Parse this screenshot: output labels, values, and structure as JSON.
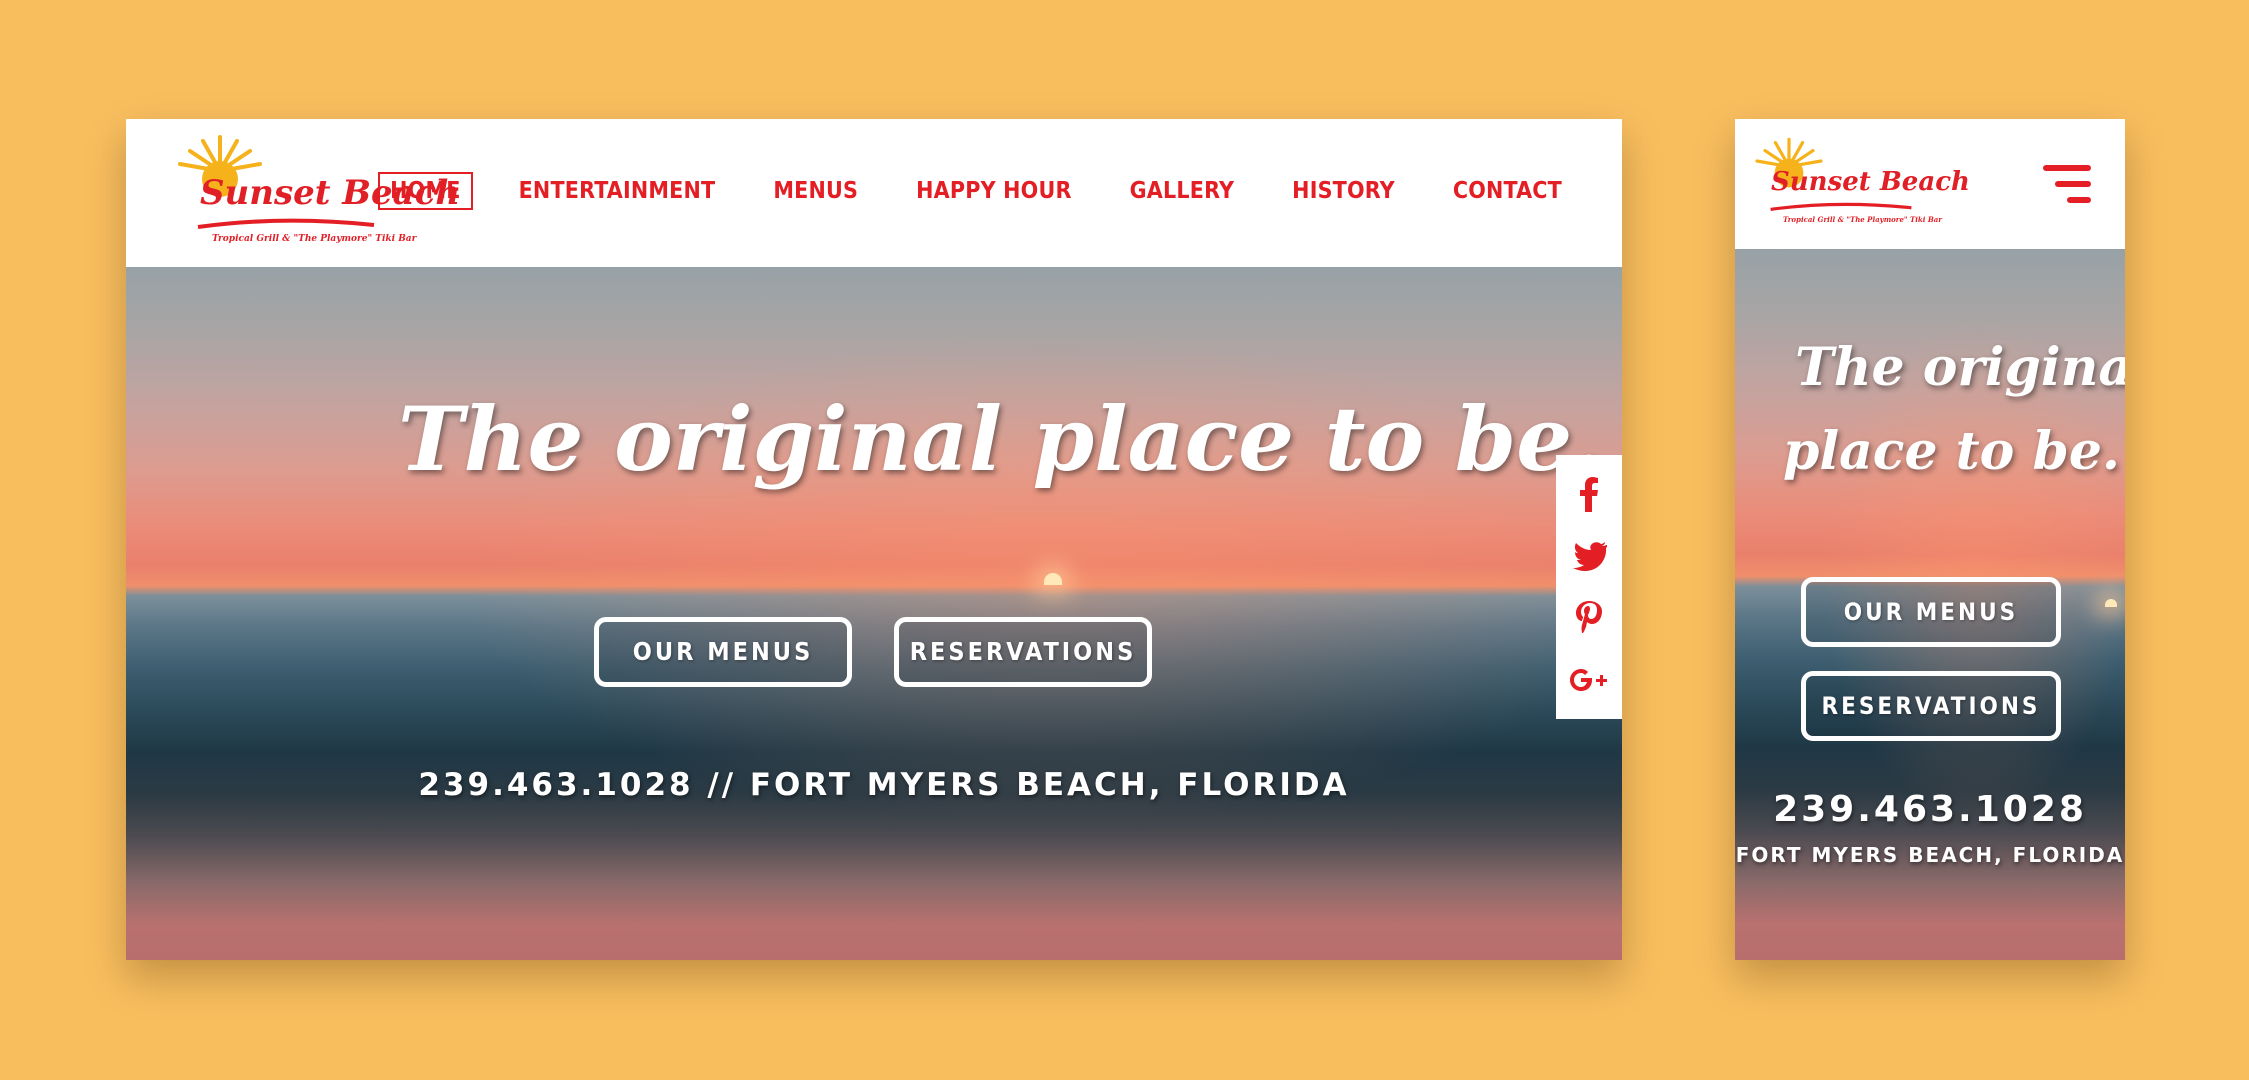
{
  "brand": {
    "name": "Sunset Beach",
    "tagline": "Tropical Grill & \"The Playmore\" Tiki Bar",
    "colors": {
      "red": "#E31E24",
      "sun_yellow": "#F6B21B",
      "backdrop": "#F8BE5E"
    }
  },
  "nav": {
    "items": [
      {
        "label": "HOME",
        "active": true
      },
      {
        "label": "ENTERTAINMENT",
        "active": false
      },
      {
        "label": "MENUS",
        "active": false
      },
      {
        "label": "HAPPY HOUR",
        "active": false
      },
      {
        "label": "GALLERY",
        "active": false
      },
      {
        "label": "HISTORY",
        "active": false
      },
      {
        "label": "CONTACT",
        "active": false
      }
    ]
  },
  "hero": {
    "headline": "The original place to be.",
    "headline_line1": "The original",
    "headline_line2": "place to be.",
    "buttons": {
      "menus": "OUR MENUS",
      "reservations": "RESERVATIONS"
    },
    "contact_line": "239.463.1028 // FORT MYERS BEACH, FLORIDA",
    "phone": "239.463.1028",
    "location": "FORT MYERS BEACH, FLORIDA"
  },
  "social": [
    {
      "icon": "facebook-icon"
    },
    {
      "icon": "twitter-icon"
    },
    {
      "icon": "pinterest-icon"
    },
    {
      "icon": "google-plus-icon"
    }
  ]
}
